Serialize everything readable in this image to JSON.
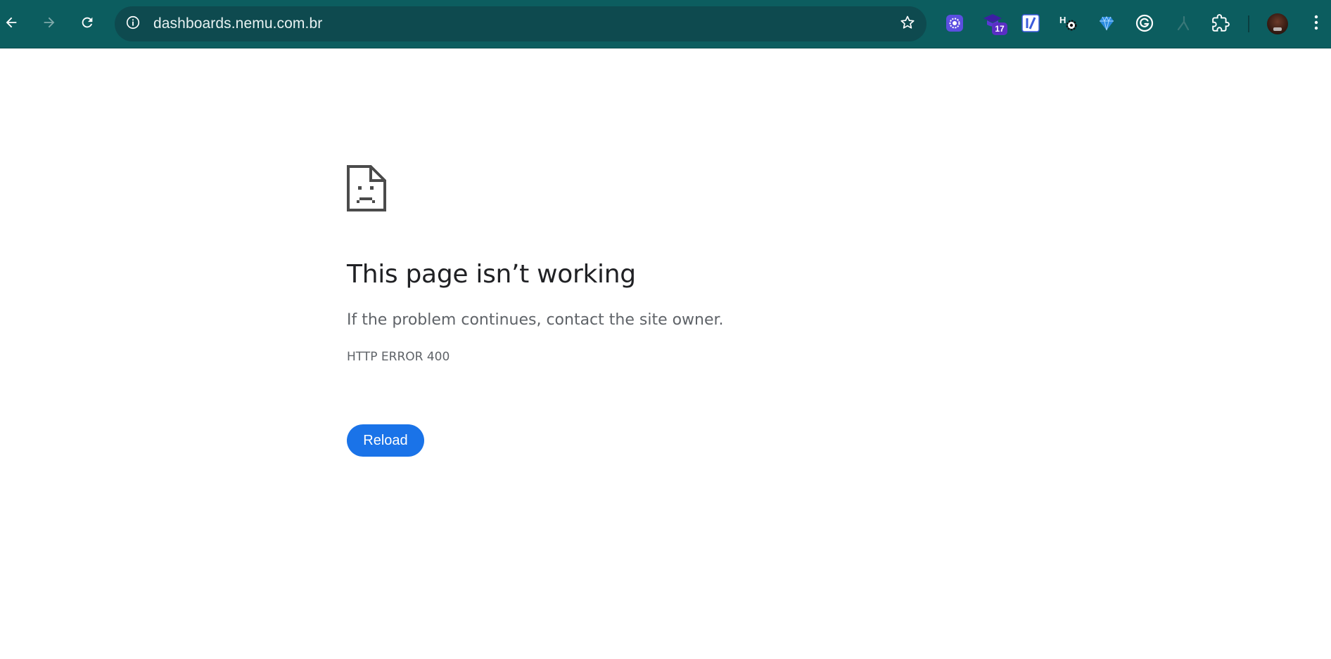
{
  "browser": {
    "url": "dashboards.nemu.com.br",
    "nav": {
      "back_icon": "arrow-left-icon",
      "forward_icon": "arrow-right-icon",
      "reload_icon": "reload-icon"
    },
    "site_info_icon": "info-icon",
    "bookmark_icon": "star-icon",
    "extensions": [
      {
        "name": "purple-gear-extension-icon",
        "badge": ""
      },
      {
        "name": "graduation-cap-extension-icon",
        "badge": "17"
      },
      {
        "name": "slash-extension-icon",
        "badge": ""
      },
      {
        "name": "hs-gear-extension-icon",
        "badge": ""
      },
      {
        "name": "diamond-extension-icon",
        "badge": ""
      },
      {
        "name": "grammarly-extension-icon",
        "badge": ""
      },
      {
        "name": "branch-extension-icon",
        "badge": ""
      },
      {
        "name": "puzzle-extension-icon",
        "badge": ""
      }
    ],
    "profile_icon": "avatar",
    "menu_icon": "kebab-menu-icon",
    "colors": {
      "toolbar": "#0c5d5f",
      "omnibox": "#0e4a4f",
      "reload_button": "#1a73e8"
    }
  },
  "error_page": {
    "icon": "sad-page-icon",
    "title": "This page isn’t working",
    "description": "If the problem continues, contact the site owner.",
    "code": "HTTP ERROR 400",
    "reload_label": "Reload"
  }
}
